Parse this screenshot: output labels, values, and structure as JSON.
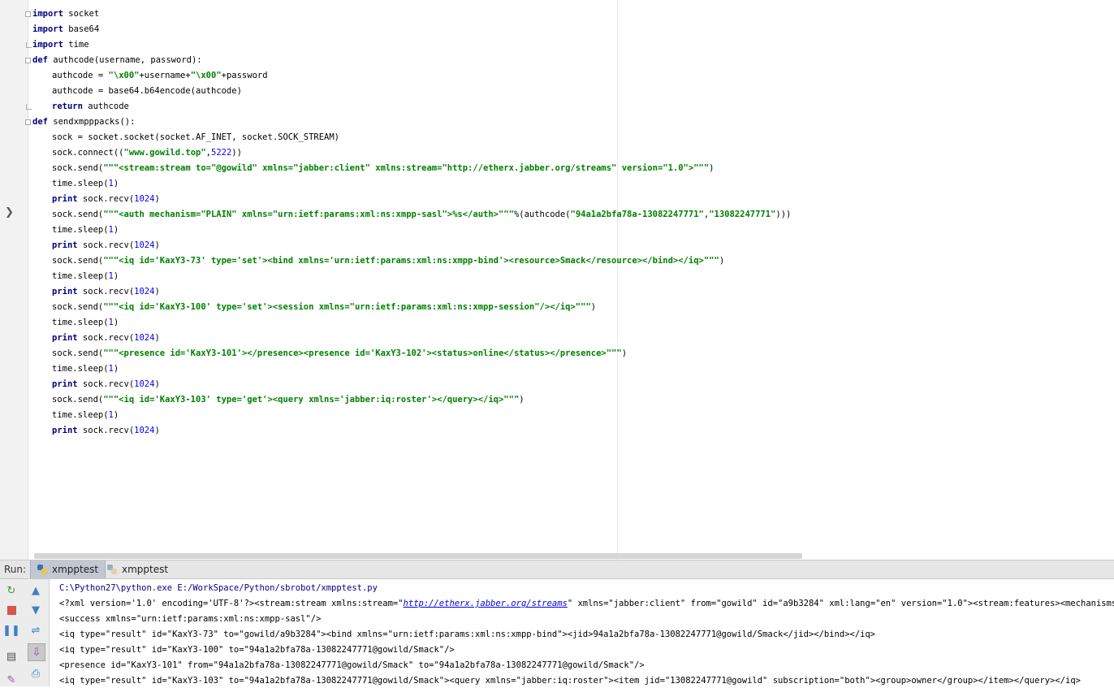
{
  "editor": {
    "gutter_mark": "❯",
    "lines": [
      {
        "indent": 0,
        "fold": "start",
        "parts": [
          [
            "kw",
            "import"
          ],
          [
            "p",
            " socket"
          ]
        ]
      },
      {
        "indent": 0,
        "fold": "",
        "parts": [
          [
            "kw",
            "import"
          ],
          [
            "p",
            " base64"
          ]
        ]
      },
      {
        "indent": 0,
        "fold": "end",
        "parts": [
          [
            "kw",
            "import"
          ],
          [
            "p",
            " time"
          ]
        ]
      },
      {
        "indent": 0,
        "fold": "start",
        "parts": [
          [
            "kw",
            "def"
          ],
          [
            "p",
            " authcode(username, password):"
          ]
        ]
      },
      {
        "indent": 1,
        "fold": "",
        "parts": [
          [
            "p",
            "authcode = "
          ],
          [
            "str",
            "\"\\x00\""
          ],
          [
            "p",
            "+username+"
          ],
          [
            "str",
            "\"\\x00\""
          ],
          [
            "p",
            "+password"
          ]
        ]
      },
      {
        "indent": 1,
        "fold": "",
        "parts": [
          [
            "p",
            "authcode = base64.b64encode(authcode)"
          ]
        ]
      },
      {
        "indent": 1,
        "fold": "end",
        "parts": [
          [
            "kw",
            "return"
          ],
          [
            "p",
            " authcode"
          ]
        ]
      },
      {
        "indent": 0,
        "fold": "start",
        "parts": [
          [
            "kw",
            "def"
          ],
          [
            "p",
            " sendxmpppacks():"
          ]
        ]
      },
      {
        "indent": 1,
        "fold": "",
        "parts": [
          [
            "p",
            "sock = socket.socket(socket.AF_INET, socket.SOCK_STREAM)"
          ]
        ]
      },
      {
        "indent": 1,
        "fold": "",
        "parts": [
          [
            "p",
            "sock.connect(("
          ],
          [
            "str",
            "\"www.gowild.top\""
          ],
          [
            "p",
            ","
          ],
          [
            "num",
            "5222"
          ],
          [
            "p",
            "))"
          ]
        ]
      },
      {
        "indent": 1,
        "fold": "",
        "parts": [
          [
            "p",
            "sock.send("
          ],
          [
            "str",
            "\"\"\"<stream:stream to=\"@gowild\" xmlns=\"jabber:client\" xmlns:stream=\"http://etherx.jabber.org/streams\" version=\"1.0\">\"\"\""
          ],
          [
            "p",
            ")"
          ]
        ]
      },
      {
        "indent": 1,
        "fold": "",
        "parts": [
          [
            "p",
            "time.sleep("
          ],
          [
            "num",
            "1"
          ],
          [
            "p",
            ")"
          ]
        ]
      },
      {
        "indent": 1,
        "fold": "",
        "parts": [
          [
            "kw",
            "print"
          ],
          [
            "p",
            " sock.recv("
          ],
          [
            "num",
            "1024"
          ],
          [
            "p",
            ")"
          ]
        ]
      },
      {
        "indent": 1,
        "fold": "",
        "parts": [
          [
            "p",
            "sock.send("
          ],
          [
            "str",
            "\"\"\"<auth mechanism=\"PLAIN\" xmlns=\"urn:ietf:params:xml:ns:xmpp-sasl\">%s</auth>\"\"\""
          ],
          [
            "p",
            "%(authcode("
          ],
          [
            "str",
            "\"94a1a2bfa78a-13082247771\""
          ],
          [
            "p",
            ","
          ],
          [
            "str",
            "\"13082247771\""
          ],
          [
            "p",
            ")))"
          ]
        ]
      },
      {
        "indent": 1,
        "fold": "",
        "parts": [
          [
            "p",
            "time.sleep("
          ],
          [
            "num",
            "1"
          ],
          [
            "p",
            ")"
          ]
        ]
      },
      {
        "indent": 1,
        "fold": "",
        "parts": [
          [
            "kw",
            "print"
          ],
          [
            "p",
            " sock.recv("
          ],
          [
            "num",
            "1024"
          ],
          [
            "p",
            ")"
          ]
        ]
      },
      {
        "indent": 1,
        "fold": "",
        "parts": [
          [
            "p",
            "sock.send("
          ],
          [
            "str",
            "\"\"\"<iq id='KaxY3-73' type='set'><bind xmlns='urn:ietf:params:xml:ns:xmpp-bind'><resource>Smack</resource></bind></iq>\"\"\""
          ],
          [
            "p",
            ")"
          ]
        ]
      },
      {
        "indent": 1,
        "fold": "",
        "parts": [
          [
            "p",
            "time.sleep("
          ],
          [
            "num",
            "1"
          ],
          [
            "p",
            ")"
          ]
        ]
      },
      {
        "indent": 1,
        "fold": "",
        "parts": [
          [
            "kw",
            "print"
          ],
          [
            "p",
            " sock.recv("
          ],
          [
            "num",
            "1024"
          ],
          [
            "p",
            ")"
          ]
        ]
      },
      {
        "indent": 1,
        "fold": "",
        "parts": [
          [
            "p",
            "sock.send("
          ],
          [
            "str",
            "\"\"\"<iq id='KaxY3-100' type='set'><session xmlns=\"urn:ietf:params:xml:ns:xmpp-session\"/></iq>\"\"\""
          ],
          [
            "p",
            ")"
          ]
        ]
      },
      {
        "indent": 1,
        "fold": "",
        "parts": [
          [
            "p",
            "time.sleep("
          ],
          [
            "num",
            "1"
          ],
          [
            "p",
            ")"
          ]
        ]
      },
      {
        "indent": 1,
        "fold": "",
        "parts": [
          [
            "kw",
            "print"
          ],
          [
            "p",
            " sock.recv("
          ],
          [
            "num",
            "1024"
          ],
          [
            "p",
            ")"
          ]
        ]
      },
      {
        "indent": 1,
        "fold": "",
        "parts": [
          [
            "p",
            "sock.send("
          ],
          [
            "str",
            "\"\"\"<presence id='KaxY3-101'></presence><presence id='KaxY3-102'><status>online</status></presence>\"\"\""
          ],
          [
            "p",
            ")"
          ]
        ]
      },
      {
        "indent": 1,
        "fold": "",
        "parts": [
          [
            "p",
            "time.sleep("
          ],
          [
            "num",
            "1"
          ],
          [
            "p",
            ")"
          ]
        ]
      },
      {
        "indent": 1,
        "fold": "",
        "parts": [
          [
            "kw",
            "print"
          ],
          [
            "p",
            " sock.recv("
          ],
          [
            "num",
            "1024"
          ],
          [
            "p",
            ")"
          ]
        ]
      },
      {
        "indent": 1,
        "fold": "",
        "parts": [
          [
            "p",
            "sock.send("
          ],
          [
            "str",
            "\"\"\"<iq id='KaxY3-103' type='get'><query xmlns='jabber:iq:roster'></query></iq>\"\"\""
          ],
          [
            "p",
            ")"
          ]
        ]
      },
      {
        "indent": 1,
        "fold": "",
        "parts": [
          [
            "p",
            "time.sleep("
          ],
          [
            "num",
            "1"
          ],
          [
            "p",
            ")"
          ]
        ]
      },
      {
        "indent": 1,
        "fold": "",
        "parts": [
          [
            "kw",
            "print"
          ],
          [
            "p",
            " sock.recv("
          ],
          [
            "num",
            "1024"
          ],
          [
            "p",
            ")"
          ]
        ]
      }
    ]
  },
  "run": {
    "label": "Run:",
    "tabs": [
      {
        "label": "xmpptest",
        "active": true
      },
      {
        "label": "xmpptest",
        "active": false
      }
    ],
    "toolbar_icons": [
      "rerun-icon",
      "up-arrow-icon",
      "stop-icon",
      "down-arrow-icon",
      "pause-icon",
      "soft-wrap-icon",
      "layout-icon",
      "scroll-to-end-icon",
      "pin-icon",
      "print-icon"
    ],
    "output": [
      {
        "type": "cmd",
        "parts": [
          [
            "p",
            "C:\\Python27\\python.exe E:/WorkSpace/Python/sbrobot/xmpptest.py"
          ]
        ]
      },
      {
        "type": "out",
        "parts": [
          [
            "p",
            "<?xml version='1.0' encoding='UTF-8'?><stream:stream xmlns:stream=\""
          ],
          [
            "link",
            "http://etherx.jabber.org/streams"
          ],
          [
            "p",
            "\" xmlns=\"jabber:client\" from=\"gowild\" id=\"a9b3284\" xml:lang=\"en\" version=\"1.0\"><stream:features><mechanisms xmlns=\"urn:ietf:params:xml:ns:xmpp-sasl\">"
          ]
        ]
      },
      {
        "type": "out",
        "parts": [
          [
            "p",
            "<success xmlns=\"urn:ietf:params:xml:ns:xmpp-sasl\"/>"
          ]
        ]
      },
      {
        "type": "out",
        "parts": [
          [
            "p",
            "<iq type=\"result\" id=\"KaxY3-73\" to=\"gowild/a9b3284\"><bind xmlns=\"urn:ietf:params:xml:ns:xmpp-bind\"><jid>94a1a2bfa78a-13082247771@gowild/Smack</jid></bind></iq>"
          ]
        ]
      },
      {
        "type": "out",
        "parts": [
          [
            "p",
            "<iq type=\"result\" id=\"KaxY3-100\" to=\"94a1a2bfa78a-13082247771@gowild/Smack\"/>"
          ]
        ]
      },
      {
        "type": "out",
        "parts": [
          [
            "p",
            "<presence id=\"KaxY3-101\" from=\"94a1a2bfa78a-13082247771@gowild/Smack\" to=\"94a1a2bfa78a-13082247771@gowild/Smack\"/>"
          ]
        ]
      },
      {
        "type": "out",
        "parts": [
          [
            "p",
            "<iq type=\"result\" id=\"KaxY3-103\" to=\"94a1a2bfa78a-13082247771@gowild/Smack\"><query xmlns=\"jabber:iq:roster\"><item jid=\"13082247771@gowild\" subscription=\"both\"><group>owner</group></item></query></iq>"
          ]
        ]
      }
    ]
  },
  "colors": {
    "keyword": "#000080",
    "string": "#008000",
    "number": "#0000ff",
    "link": "#0000ee"
  }
}
